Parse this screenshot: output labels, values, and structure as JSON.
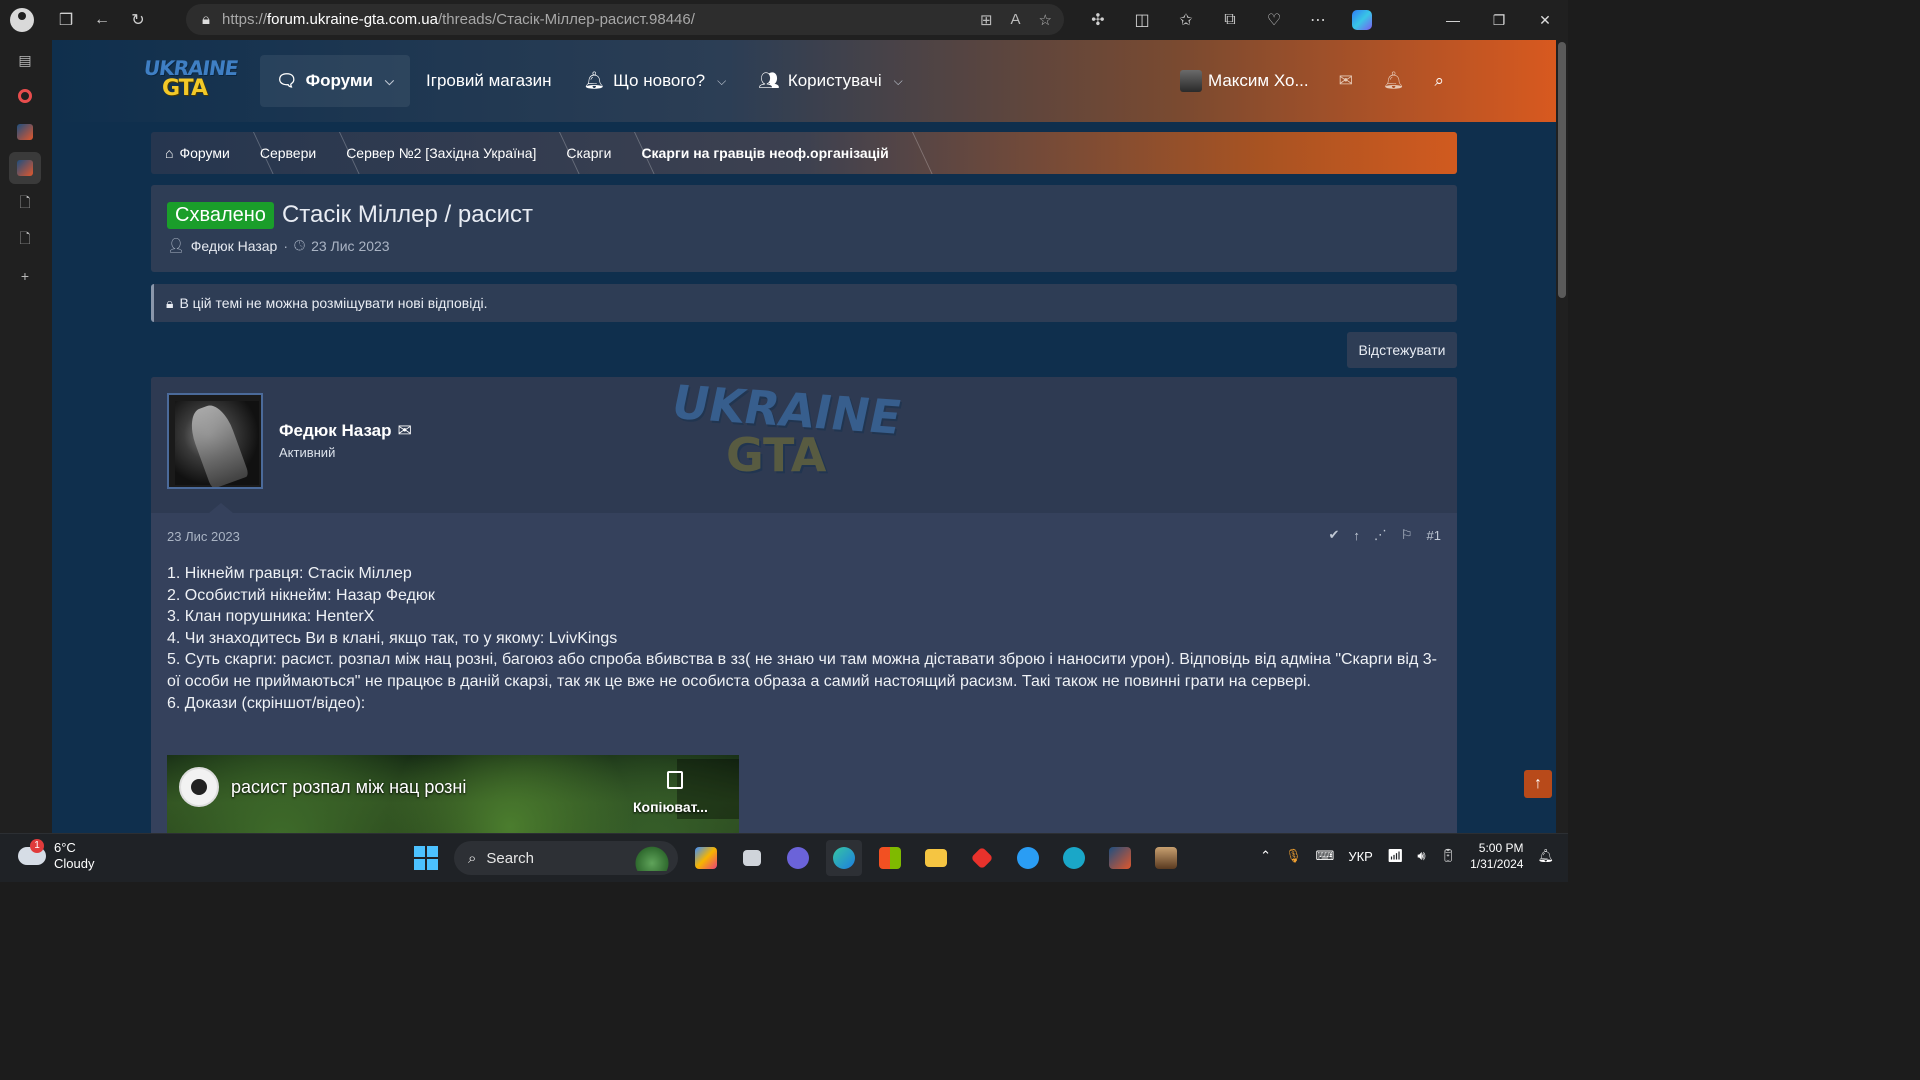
{
  "browser": {
    "url_prefix": "https://",
    "url_host": "forum.ukraine-gta.com.ua",
    "url_path": "/threads/Стасік-Міллер-расист.98446/"
  },
  "site": {
    "logo_line1": "UKRAINE",
    "logo_line2": "GTA",
    "nav": [
      {
        "label": "Форуми",
        "has_menu": true
      },
      {
        "label": "Ігровий магазин",
        "has_menu": false
      },
      {
        "label": "Що нового?",
        "has_menu": true
      },
      {
        "label": "Користувачі",
        "has_menu": true
      }
    ],
    "user_name": "Максим Хо..."
  },
  "breadcrumb": [
    "Форуми",
    "Сервери",
    "Сервер №2 [Західна Україна]",
    "Скарги",
    "Скарги на гравців неоф.організацій"
  ],
  "thread": {
    "status_badge": "Схвалено",
    "title": "Стасік Міллер / расист",
    "author": "Федюк Назар",
    "separator": "·",
    "date": "23 Лис 2023",
    "locked_notice": "В цій темі не можна розміщувати нові відповіді.",
    "watch_label": "Відстежувати"
  },
  "post": {
    "user_name": "Федюк Назар",
    "user_title": "Активний",
    "watermark_line1": "UKRAINE",
    "watermark_line2": "GTA",
    "date": "23 Лис 2023",
    "number": "#1",
    "lines": [
      "1. Нікнейм гравця: Стасік Міллер",
      "2. Особистий нікнейм: Назар Федюк",
      "3. Клан порушника: HenterX",
      "4. Чи знаходитесь Ви в клані, якщо так, то у якому: LvivKings",
      "5. Суть скарги: расист. розпал між нац розні, багоюз або спроба вбивства в зз( не знаю чи там можна діставати зброю і наносити урон). Відповідь від адміна \"Скарги від 3-ої особи не приймаються\" не працює в даній скарзі, так як це вже не особиста образа а самий настоящий расизм. Такі також не повинні грати на сервері.",
      "6. Докази (скріншот/відео):"
    ],
    "video_title": "расист розпал між нац розні",
    "video_copy_label": "Копіюват..."
  },
  "taskbar": {
    "temperature": "6°C",
    "condition": "Cloudy",
    "weather_badge": "1",
    "search_label": "Search",
    "language": "УКР",
    "time": "5:00 PM",
    "date": "1/31/2024"
  },
  "colors": {
    "badge_green": "#1a9e2a",
    "header_orange": "#d8591f",
    "page_bg": "#0f2f4d"
  }
}
